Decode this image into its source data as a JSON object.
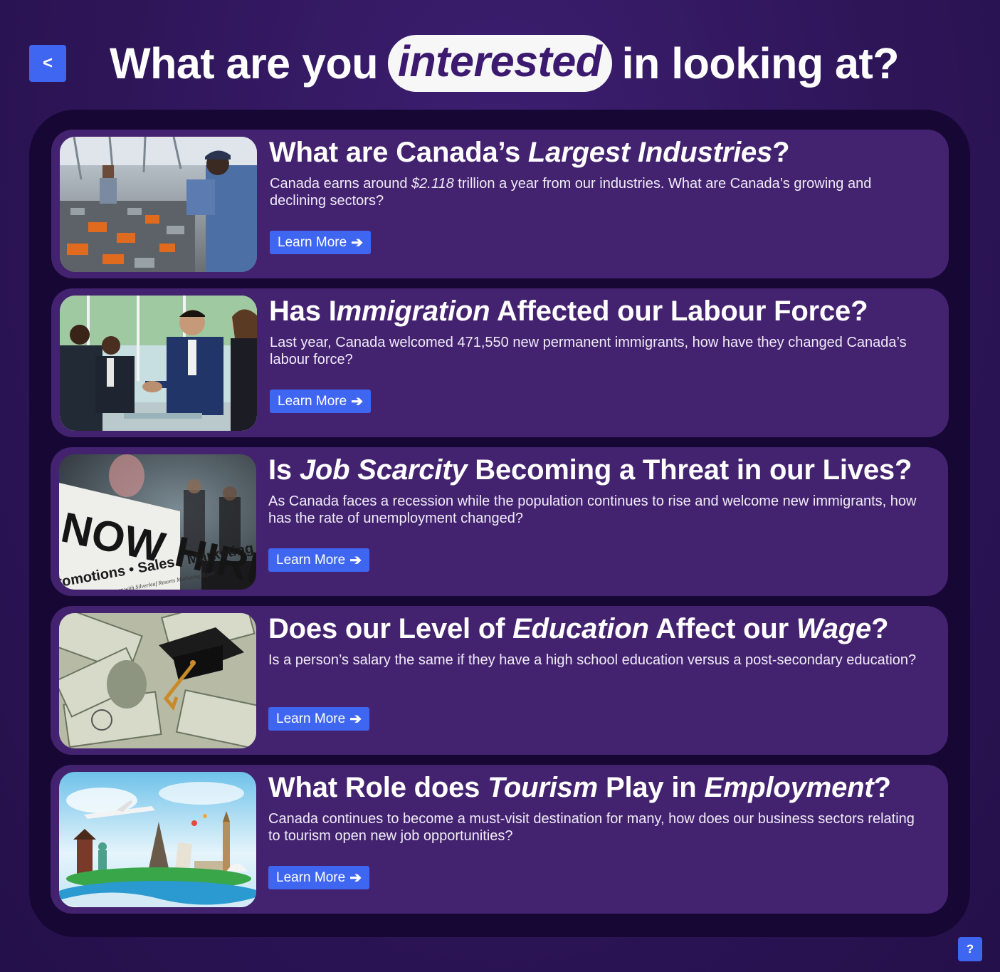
{
  "header": {
    "back_label": "<",
    "title_before": "What are you",
    "title_highlight": "interested",
    "title_after": "in looking at?"
  },
  "cards": [
    {
      "title_parts": [
        "What are Canada’s ",
        "Largest Industries",
        "?"
      ],
      "desc_parts": [
        "Canada earns around ",
        "$2.118",
        " trillion a year from our industries. What are Canada’s growing and declining sectors?"
      ],
      "button_label": "Learn More",
      "image_icon": "factory-workers-photo"
    },
    {
      "title_parts": [
        "Has I",
        "mmigration",
        " Affected our Labour Force?"
      ],
      "desc": "Last year, Canada welcomed 471,550 new permanent immigrants, how have they changed Canada’s labour force?",
      "button_label": "Learn More",
      "image_icon": "business-handshake-photo"
    },
    {
      "title_parts": [
        "Is ",
        "Job Scarcity",
        " Becoming a Threat in our Lives?"
      ],
      "desc": "As Canada faces a recession while the population continues to rise and welcome new immigrants, how has the rate of unemployment changed?",
      "button_label": "Learn More",
      "image_icon": "now-hiring-sign-photo",
      "image_text": {
        "sign_line1": "NOW HIRING",
        "sign_line2": "romotions • Sales • Marketing",
        "sign_line3": "ur career with Silverleaf Resorts Marketing Team!"
      }
    },
    {
      "title_parts": [
        "Does our Level of ",
        "Education",
        " Affect our ",
        "Wage",
        "?"
      ],
      "desc": "Is a person’s salary the same if they have a high school education versus a post-secondary education?",
      "button_label": "Learn More",
      "image_icon": "money-graduation-cap-photo"
    },
    {
      "title_parts": [
        "What Role does ",
        "Tourism",
        " Play in ",
        "Employment",
        "?"
      ],
      "desc": "Canada continues to become a must-visit destination for many, how does our business sectors relating to tourism open new job opportunities?",
      "button_label": "Learn More",
      "image_icon": "world-landmarks-photo"
    }
  ],
  "help": {
    "label": "?"
  },
  "colors": {
    "background": "#2e1558",
    "panel": "#170735",
    "card": "#43226f",
    "button": "#3f66f0",
    "pill": "#f7f7f8"
  }
}
